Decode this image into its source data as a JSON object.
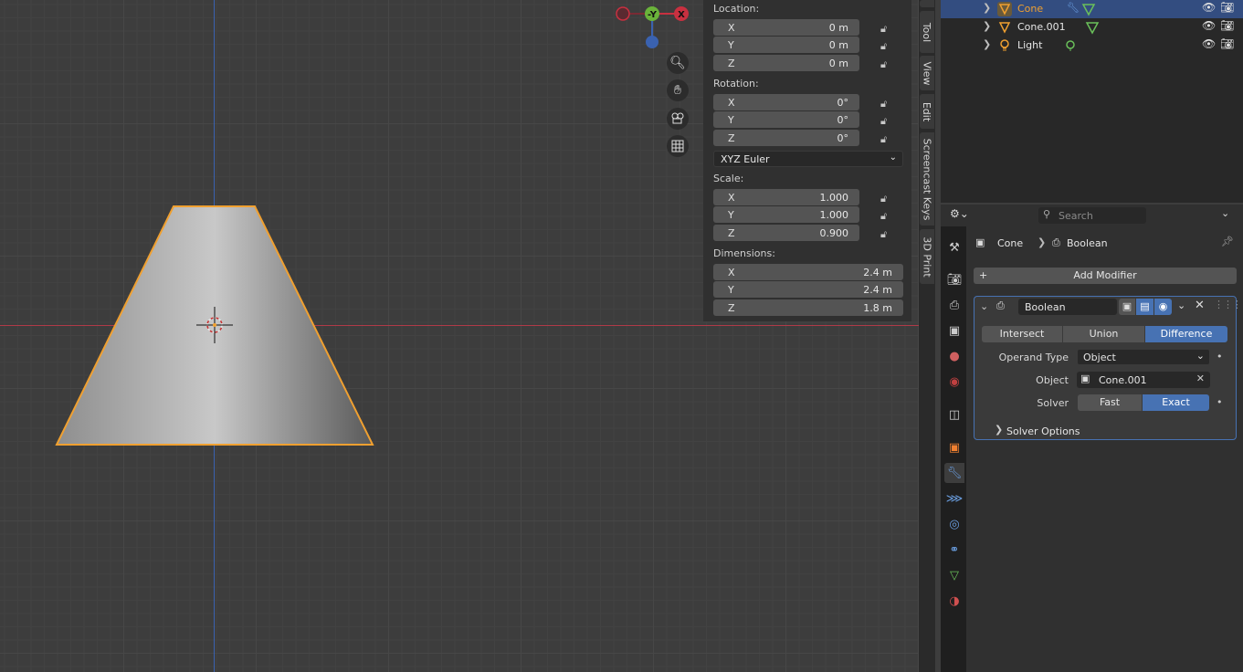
{
  "outliner": {
    "items": [
      {
        "name": "Cone",
        "selected": true
      },
      {
        "name": "Cone.001",
        "selected": false
      },
      {
        "name": "Light",
        "selected": false
      }
    ]
  },
  "npanel": {
    "location_label": "Location:",
    "location": {
      "x": "0 m",
      "y": "0 m",
      "z": "0 m"
    },
    "rotation_label": "Rotation:",
    "rotation": {
      "x": "0°",
      "y": "0°",
      "z": "0°"
    },
    "rotation_mode": "XYZ Euler",
    "scale_label": "Scale:",
    "scale": {
      "x": "1.000",
      "y": "1.000",
      "z": "0.900"
    },
    "dimensions_label": "Dimensions:",
    "dimensions": {
      "x": "2.4 m",
      "y": "2.4 m",
      "z": "1.8 m"
    },
    "axis_labels": {
      "x": "X",
      "y": "Y",
      "z": "Z"
    }
  },
  "sidetabs": [
    "Tool",
    "View",
    "Edit",
    "Screencast Keys",
    "3D Print"
  ],
  "gizmo": {
    "y": "-Y",
    "x": "X"
  },
  "properties": {
    "search_placeholder": "Search",
    "breadcrumb_object": "Cone",
    "breadcrumb_modifier": "Boolean",
    "add_modifier": "Add Modifier",
    "modifier": {
      "name": "Boolean",
      "ops": [
        "Intersect",
        "Union",
        "Difference"
      ],
      "active_op": "Difference",
      "operand_type_label": "Operand Type",
      "operand_type": "Object",
      "object_label": "Object",
      "object": "Cone.001",
      "solver_label": "Solver",
      "solver_fast": "Fast",
      "solver_exact": "Exact",
      "solver_options": "Solver Options"
    }
  },
  "colors": {
    "accent": "#4772b3",
    "selection": "#f0a030",
    "axis_x": "#b03a48",
    "axis_y": "#3a62b0"
  }
}
